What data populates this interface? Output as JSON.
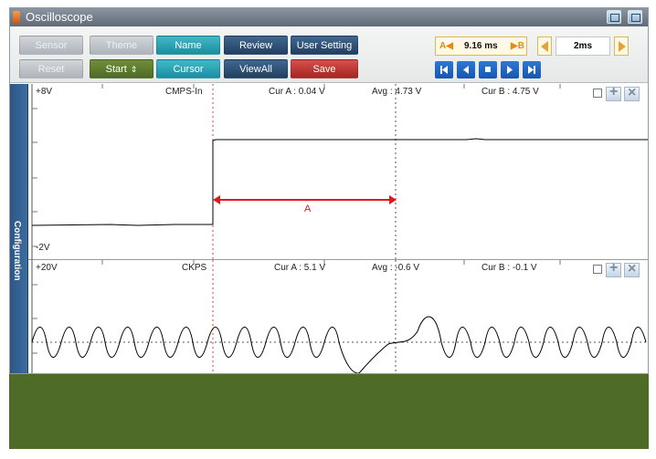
{
  "app": {
    "title": "Oscilloscope"
  },
  "toolbar": {
    "sensor": "Sensor",
    "theme": "Theme",
    "name": "Name",
    "review": "Review",
    "user_setting": "User Setting",
    "reset": "Reset",
    "start": "Start",
    "start_icon": "updown-arrow",
    "cursor": "Cursor",
    "viewall": "ViewAll",
    "save": "Save"
  },
  "time_panel": {
    "a_marker": "A◀",
    "cursor_time": "9.16 ms",
    "b_marker": "▶B",
    "timebase": "2ms"
  },
  "config_tab": "Configuration",
  "channels": [
    {
      "top_label": "+8V",
      "bottom_label": "-2V",
      "sensor": "CMPS-In",
      "cur_a": "Cur A : 0.04 V",
      "avg": "Avg : 4.73 V",
      "cur_b": "Cur B : 4.75 V",
      "cursor_label": "A"
    },
    {
      "top_label": "+20V",
      "sensor": "CKPS",
      "cur_a": "Cur A : 5.1 V",
      "avg": "Avg : -0.6 V",
      "cur_b": "Cur B : -0.1 V"
    }
  ],
  "colors": {
    "title_bar": "#6b7581",
    "cursor_line": "#d84438",
    "bottom_band": "#4e6b27",
    "nav_buttons": "#1c63bf"
  }
}
